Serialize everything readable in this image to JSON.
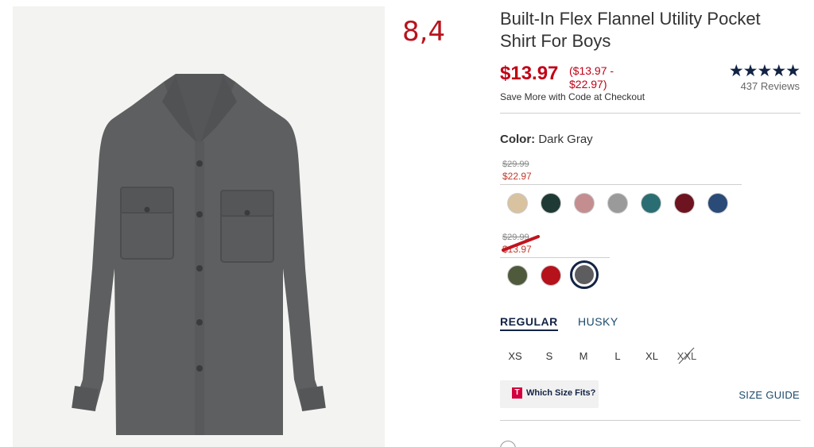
{
  "overlay_number": "8,4",
  "product": {
    "title": "Built-In Flex Flannel Utility Pocket Shirt For Boys",
    "price": "$13.97",
    "price_range": "($13.97 - $22.97)",
    "save_more": "Save More with Code at Checkout",
    "rating_stars": "★★★★★",
    "reviews": "437 Reviews"
  },
  "color": {
    "label": "Color:",
    "value": "Dark Gray"
  },
  "swatch_groups": [
    {
      "old_price": "$29.99",
      "new_price": "$22.97",
      "swatches": [
        {
          "name": "tan-plaid",
          "color": "#d9c2a0"
        },
        {
          "name": "green-plaid",
          "color": "#1f3a34"
        },
        {
          "name": "pink-plaid",
          "color": "#c48e90"
        },
        {
          "name": "black-white-plaid",
          "color": "#9a9a9a"
        },
        {
          "name": "teal-plaid",
          "color": "#2a6e73"
        },
        {
          "name": "burgundy",
          "color": "#6e1420"
        },
        {
          "name": "navy-plaid",
          "color": "#2a4a78"
        }
      ]
    },
    {
      "old_price": "$29.99",
      "new_price": "$13.97",
      "swatches": [
        {
          "name": "red-green-plaid",
          "color": "#4f5a3c"
        },
        {
          "name": "red-buffalo",
          "color": "#b5121b"
        },
        {
          "name": "dark-gray",
          "color": "#5d5d5f",
          "selected": true
        }
      ]
    }
  ],
  "fit_tabs": [
    "REGULAR",
    "HUSKY"
  ],
  "sizes": [
    "XS",
    "S",
    "M",
    "L",
    "XL",
    "XXL"
  ],
  "which_size": {
    "logo_letter": "T",
    "label": "Which Size Fits?"
  },
  "size_guide": "SIZE GUIDE",
  "colors": {
    "accent_red": "#c10015",
    "navy": "#122344",
    "link_blue": "#1a4a6b"
  }
}
